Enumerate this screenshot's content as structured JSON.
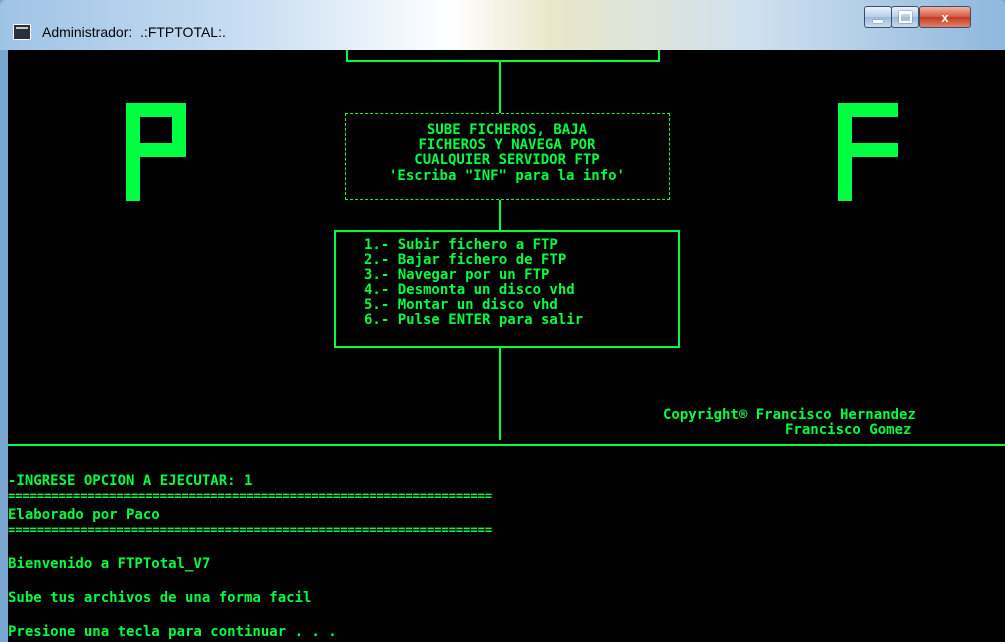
{
  "window": {
    "title": "Administrador:  .:FTPTOTAL:.",
    "buttons": {
      "minimize": "minimize",
      "maximize": "maximize",
      "close": "x"
    }
  },
  "banner": {
    "left_letter": "P",
    "right_letter": "F",
    "info_lines": [
      "SUBE FICHEROS, BAJA",
      "FICHEROS Y NAVEGA POR",
      "CUALQUIER SERVIDOR FTP",
      "'Escriba \"INF\" para la info'"
    ],
    "menu": [
      "1.- Subir fichero a FTP",
      "2.- Bajar fichero de FTP",
      "3.- Navegar por un FTP",
      "4.- Desmonta un disco vhd",
      "5.- Montar un disco vhd",
      "6.- Pulse ENTER para salir"
    ],
    "copyright_line1": "Copyright® Francisco Hernandez",
    "copyright_line2": "Francisco Gomez"
  },
  "output": {
    "prompt": "-INGRESE OPCION A EJECUTAR: 1",
    "separator": "===================================================================",
    "author": "Elaborado por Paco",
    "welcome": "Bienvenido a FTPTotal_V7",
    "tagline": "Sube tus archivos de una forma facil",
    "continue": "Presione una tecla para continuar . . ."
  },
  "colors": {
    "console_bg": "#000000",
    "console_fg": "#00ff40"
  }
}
